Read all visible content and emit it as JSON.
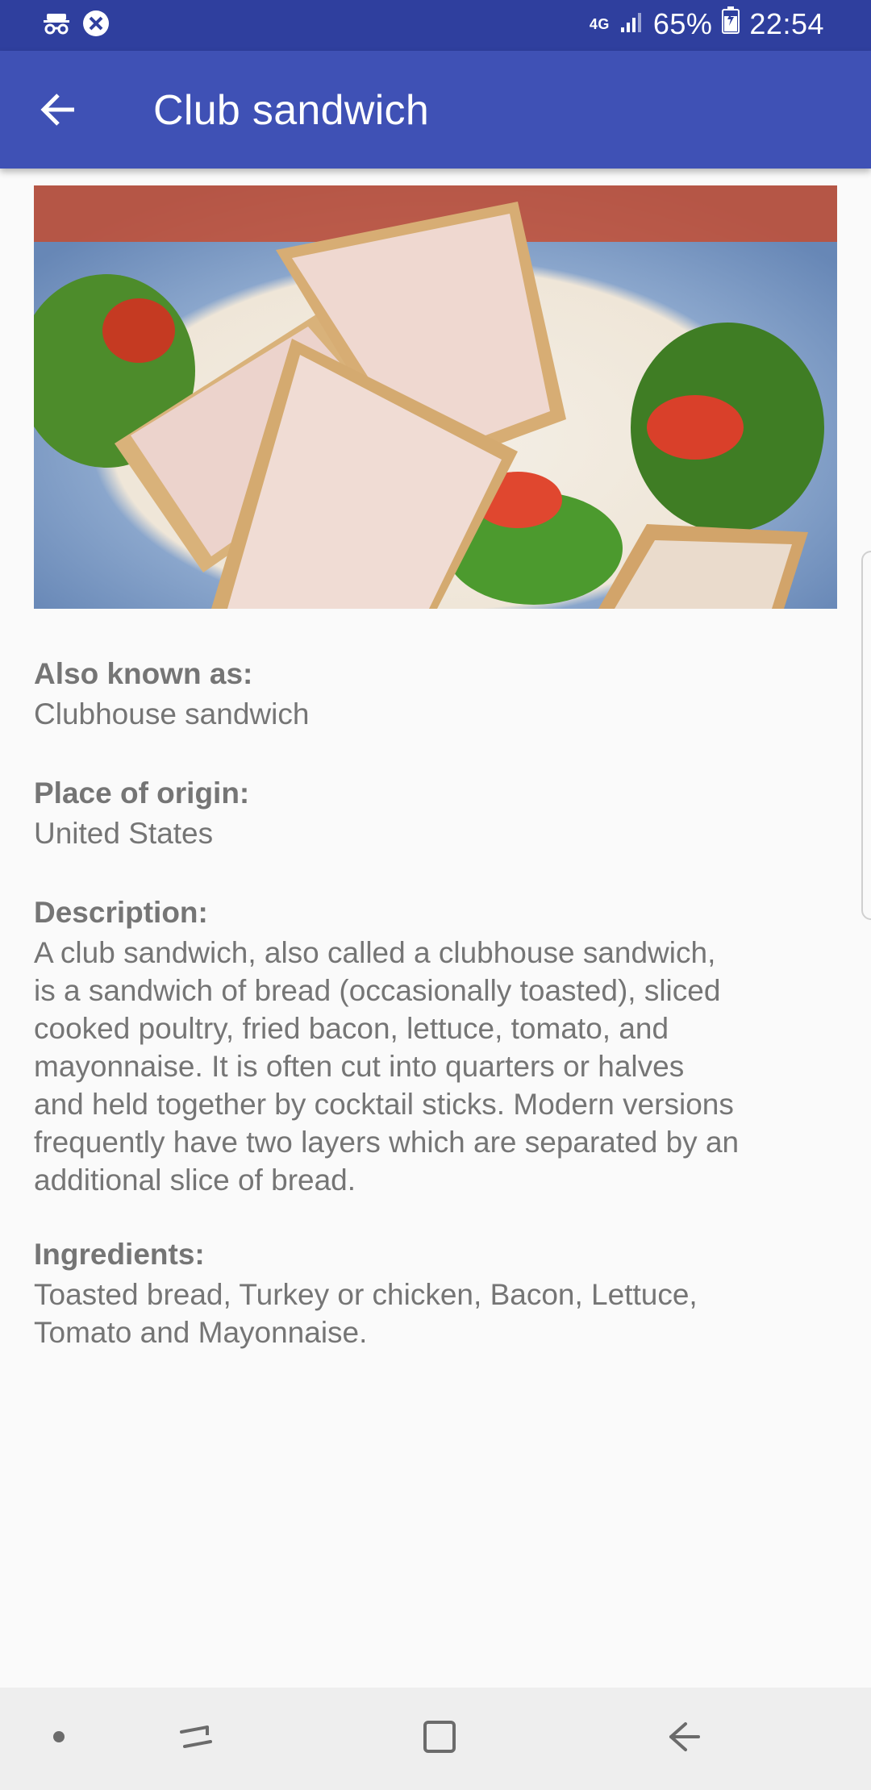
{
  "status_bar": {
    "network": "4G",
    "battery_percent": "65%",
    "time": "22:54",
    "left_icons": [
      "incognito-icon",
      "no-sync-icon"
    ],
    "right_icons": [
      "network-4g-icon",
      "signal-icon",
      "battery-icon"
    ]
  },
  "app_bar": {
    "title": "Club sandwich",
    "back_icon": "arrow-left-icon",
    "color": "#3f51b5"
  },
  "hero_image": {
    "subject": "club sandwich quarters on a blue-rimmed plate"
  },
  "details": {
    "also_known_as": {
      "label": "Also known as:",
      "value": "Clubhouse sandwich"
    },
    "place_of_origin": {
      "label": "Place of origin:",
      "value": "United States"
    },
    "description": {
      "label": "Description:",
      "value": "A club sandwich, also called a clubhouse sandwich,\nis a sandwich of bread (occasionally toasted), sliced\ncooked poultry, fried bacon, lettuce, tomato, and\nmayonnaise. It is often cut into quarters or halves\nand held together by cocktail sticks. Modern versions\nfrequently have two layers which are separated by an\nadditional slice of bread."
    },
    "ingredients": {
      "label": "Ingredients:",
      "value": "Toasted bread, Turkey or chicken, Bacon, Lettuce,\nTomato and Mayonnaise."
    }
  },
  "nav_bar": {
    "icons": [
      "dot-icon",
      "recents-icon",
      "home-icon",
      "back-icon"
    ]
  }
}
